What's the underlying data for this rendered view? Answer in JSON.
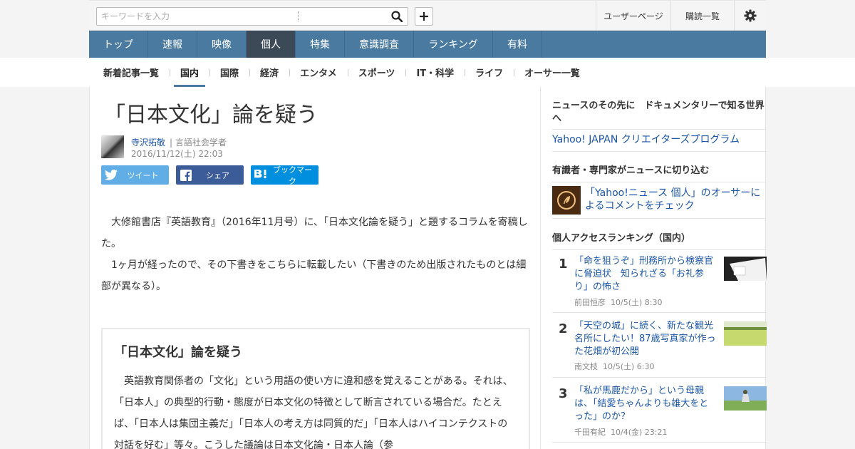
{
  "search": {
    "placeholder": "キーワードを入力"
  },
  "topbar": {
    "user_page": "ユーザーページ",
    "subscriptions": "購読一覧"
  },
  "mainnav": [
    {
      "label": "トップ"
    },
    {
      "label": "速報"
    },
    {
      "label": "映像"
    },
    {
      "label": "個人",
      "active": true
    },
    {
      "label": "特集"
    },
    {
      "label": "意識調査"
    },
    {
      "label": "ランキング"
    },
    {
      "label": "有料"
    }
  ],
  "subnav": [
    {
      "label": "新着記事一覧"
    },
    {
      "label": "国内",
      "active": true
    },
    {
      "label": "国際"
    },
    {
      "label": "経済"
    },
    {
      "label": "エンタメ"
    },
    {
      "label": "スポーツ"
    },
    {
      "label": "IT・科学"
    },
    {
      "label": "ライフ"
    },
    {
      "label": "オーサー一覧"
    }
  ],
  "article": {
    "title": "「日本文化」論を疑う",
    "author_name": "寺沢拓敬",
    "author_role": "| 言語社会学者",
    "date": "2016/11/12(土) 22:03",
    "share": {
      "tweet": "ツイート",
      "facebook": "シェア",
      "hatena": "ブックマーク"
    },
    "paragraphs": [
      "大修館書店『英語教育』（2016年11月号）に、「日本文化論を疑う」と題するコラムを寄稿した。",
      "1ヶ月が経ったので、その下書きをこちらに転載したい（下書きのため出版されたものとは細部が異なる）。"
    ],
    "box_title": "「日本文化」論を疑う",
    "box_text": "英語教育関係者の「文化」という用語の使い方に違和感を覚えることがある。それは、「日本人」の典型的行動・態度が日本文化の特徴として断言されている場合だ。たとえば、「日本人は集団主義だ」「日本人の考え方は同質的だ」「日本人はハイコンテクストの対話を好む」等々。こうした議論は日本文化論・日本人論（参"
  },
  "sidebar": {
    "doc_heading": "ニュースのその先に　ドキュメンタリーで知る世界へ",
    "doc_link": "Yahoo! JAPAN クリエイターズプログラム",
    "expert_heading": "有識者・専門家がニュースに切り込む",
    "expert_link": "「Yahoo!ニュース 個人」のオーサーによるコメントをチェック",
    "ranking_heading": "個人アクセスランキング（国内）",
    "ranking": [
      {
        "rank": "1",
        "title": "「命を狙うぞ」刑務所から検察官に脅迫状　知られざる「お礼参り」の怖さ",
        "author": "前田恒彦",
        "date": "10/5(土) 8:30"
      },
      {
        "rank": "2",
        "title": "「天空の城」に続く、新たな観光名所にしたい！87歳写真家が作った花畑が初公開",
        "author": "南文枝",
        "date": "10/5(土) 6:30"
      },
      {
        "rank": "3",
        "title": "「私が馬鹿だから」という母親は、「結愛ちゃんよりも雄大をとった」のか？",
        "author": "千田有紀",
        "date": "10/4(金) 23:21"
      }
    ]
  },
  "colors": {
    "nav": "#4a7aa0",
    "nav_active": "#3c4a58",
    "link": "#1a55a8",
    "twitter": "#61aee6",
    "facebook": "#3b5b99",
    "hatena": "#008fde"
  }
}
